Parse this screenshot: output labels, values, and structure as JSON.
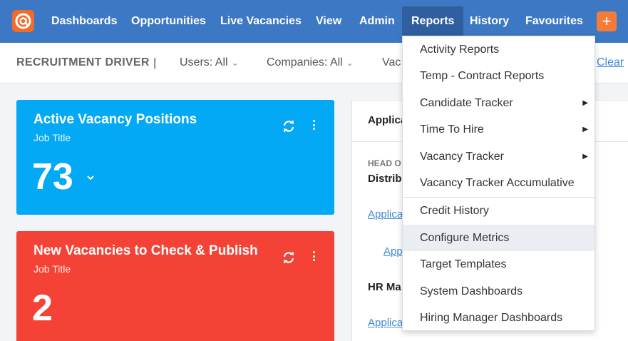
{
  "nav": {
    "items": [
      "Dashboards",
      "Opportunities",
      "Live Vacancies",
      "View",
      "Admin",
      "Reports",
      "History",
      "Favourites"
    ],
    "active": "Reports",
    "plus_label": "+"
  },
  "filterbar": {
    "title": "RECRUITMENT DRIVER",
    "separator": "|",
    "filters": [
      "Users: All",
      "Companies: All",
      "Vac"
    ],
    "clear_label": "Clear"
  },
  "cards": [
    {
      "title": "Active Vacancy Positions",
      "subtitle": "Job Title",
      "value": "73",
      "has_chevron": true
    },
    {
      "title": "New Vacancies to Check & Publish",
      "subtitle": "Job Title",
      "value": "2",
      "has_chevron": false
    }
  ],
  "panel": {
    "heading": "Applica",
    "section1_caps": "HEAD O",
    "section1_bold": "Distrib",
    "link1": "Applica",
    "link2": "Appl",
    "section2_bold": "HR Ma",
    "link3": "Applica"
  },
  "reports_menu": {
    "group1": [
      {
        "label": "Activity Reports",
        "submenu": false
      },
      {
        "label": "Temp - Contract Reports",
        "submenu": false
      },
      {
        "label": "Candidate Tracker",
        "submenu": true
      },
      {
        "label": "Time To Hire",
        "submenu": true
      },
      {
        "label": "Vacancy Tracker",
        "submenu": true
      },
      {
        "label": "Vacancy Tracker Accumulative",
        "submenu": false
      }
    ],
    "group2": [
      {
        "label": "Credit History",
        "submenu": false
      },
      {
        "label": "Configure Metrics",
        "submenu": false,
        "hovered": true
      },
      {
        "label": "Target Templates",
        "submenu": false
      },
      {
        "label": "System Dashboards",
        "submenu": false
      },
      {
        "label": "Hiring Manager Dashboards",
        "submenu": false
      }
    ]
  },
  "colors": {
    "nav_bg": "#3c78c3",
    "nav_active": "#2f5f9e",
    "card_blue": "#03a9f4",
    "card_red": "#f44336",
    "accent_orange": "#f47b3a",
    "link": "#3c8ad6"
  }
}
